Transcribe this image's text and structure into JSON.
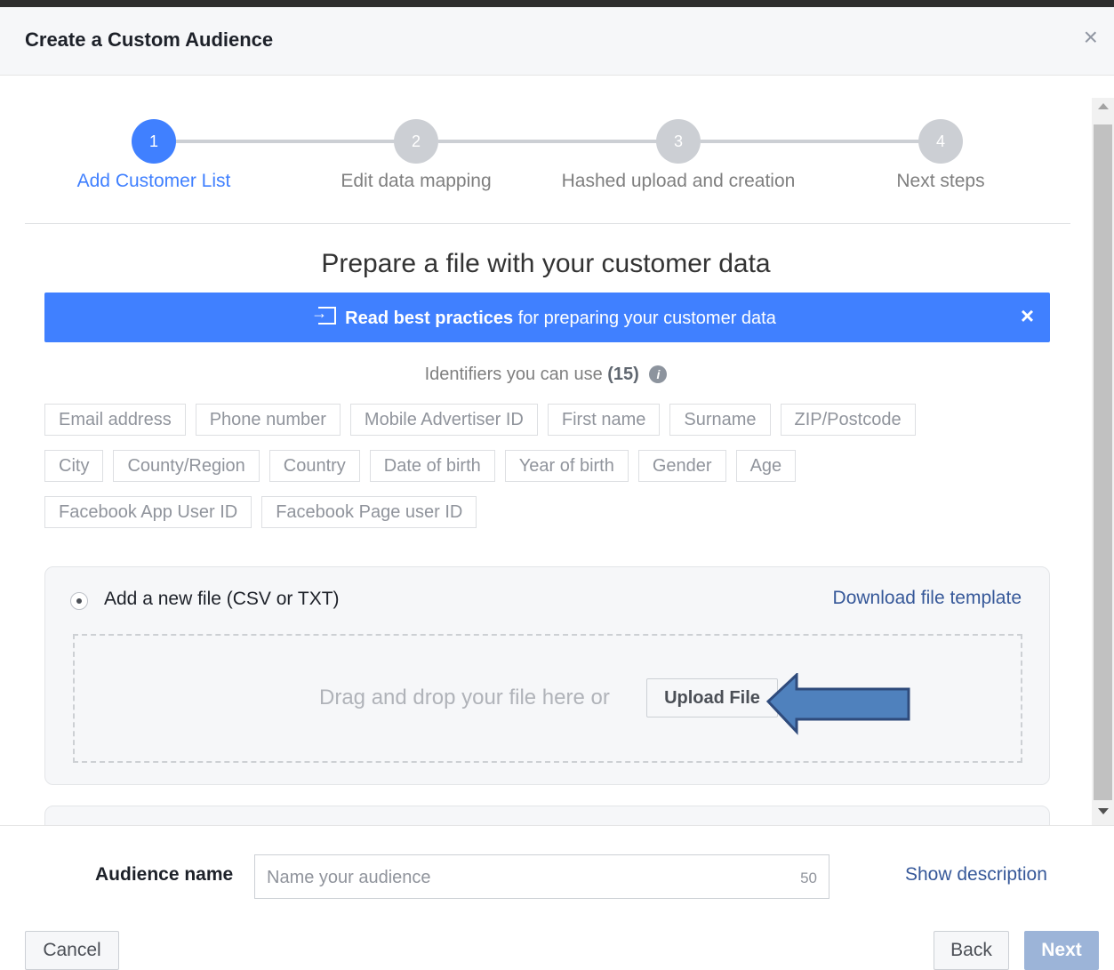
{
  "dialog": {
    "title": "Create a Custom Audience",
    "close_symbol": "×"
  },
  "stepper": {
    "steps": [
      {
        "number": "1",
        "label": "Add Customer List",
        "active": true
      },
      {
        "number": "2",
        "label": "Edit data mapping",
        "active": false
      },
      {
        "number": "3",
        "label": "Hashed upload and creation",
        "active": false
      },
      {
        "number": "4",
        "label": "Next steps",
        "active": false
      }
    ]
  },
  "section": {
    "title": "Prepare a file with your customer data"
  },
  "banner": {
    "link_text": "Read best practices",
    "rest_text": " for preparing your customer data",
    "close_symbol": "×",
    "color": "#4080ff"
  },
  "identifiers": {
    "heading": "Identifiers you can use",
    "count": "(15)",
    "info_symbol": "i",
    "items": [
      "Email address",
      "Phone number",
      "Mobile Advertiser ID",
      "First name",
      "Surname",
      "ZIP/Postcode",
      "City",
      "County/Region",
      "Country",
      "Date of birth",
      "Year of birth",
      "Gender",
      "Age",
      "Facebook App User ID",
      "Facebook Page user ID"
    ]
  },
  "upload_panel": {
    "radio_label": "Add a new file (CSV or TXT)",
    "download_link": "Download file template",
    "drop_text": "Drag and drop your file here or",
    "upload_button": "Upload File"
  },
  "footer": {
    "audience_label": "Audience name",
    "audience_placeholder": "Name your audience",
    "char_limit": "50",
    "show_description": "Show description",
    "cancel": "Cancel",
    "back": "Back",
    "next": "Next"
  }
}
